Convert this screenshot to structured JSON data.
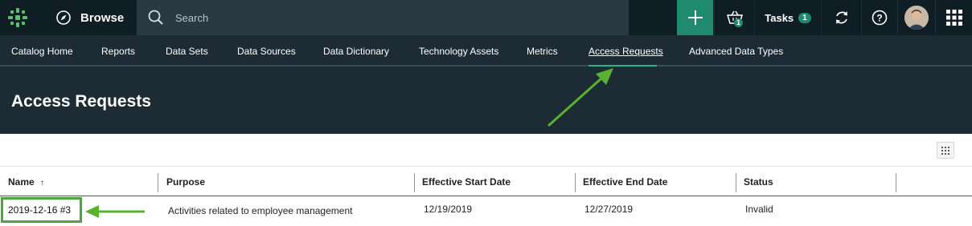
{
  "topbar": {
    "browse_label": "Browse",
    "search_placeholder": "Search",
    "basket_count": "1",
    "tasks_label": "Tasks",
    "tasks_count": "1",
    "accent_color": "#1f8a6d"
  },
  "nav": {
    "items": [
      {
        "label": "Catalog Home"
      },
      {
        "label": "Reports"
      },
      {
        "label": "Data Sets"
      },
      {
        "label": "Data Sources"
      },
      {
        "label": "Data Dictionary"
      },
      {
        "label": "Technology Assets"
      },
      {
        "label": "Metrics"
      },
      {
        "label": "Access Requests"
      },
      {
        "label": "Advanced Data Types"
      }
    ]
  },
  "page": {
    "title": "Access Requests"
  },
  "table": {
    "columns": [
      "Name",
      "Purpose",
      "Effective Start Date",
      "Effective End Date",
      "Status"
    ],
    "rows": [
      {
        "name": "2019-12-16 #3",
        "purpose": "Activities related to employee management",
        "start": "12/19/2019",
        "end": "12/27/2019",
        "status": "Invalid"
      }
    ]
  },
  "annotation_color": "#5ab031"
}
